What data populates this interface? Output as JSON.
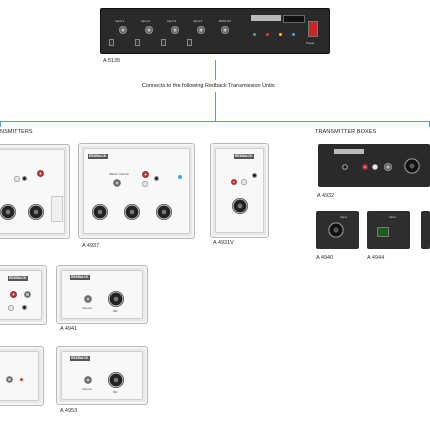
{
  "main_unit": {
    "model": "A 5135",
    "inputs": [
      "Input 1",
      "Input 2",
      "Input 3",
      "Input 4"
    ],
    "bgm_vol": "BGM Vol",
    "power_label": "Power",
    "brand": "REDBACK"
  },
  "connects_text": "Connects to the following Redback Transmission Units",
  "sections": {
    "wall_plates_header": "NSMITTERS",
    "boxes_header": "TRANSMITTER BOXES"
  },
  "plates": [
    {
      "id": "p1",
      "model": ""
    },
    {
      "id": "p2",
      "model": "A 4937"
    },
    {
      "id": "p3",
      "model": "A 4931V"
    },
    {
      "id": "p4",
      "model": ""
    },
    {
      "id": "p5",
      "model": "A 4941"
    },
    {
      "id": "p6",
      "model": ""
    },
    {
      "id": "p7",
      "model": "A 4953"
    }
  ],
  "boxes": [
    {
      "id": "b1",
      "model": "A 4932"
    },
    {
      "id": "b2",
      "model": "A 4940"
    },
    {
      "id": "b3",
      "model": "A 4944"
    }
  ],
  "plate_small_text": {
    "volume": "Volume",
    "mic": "Mic",
    "music": "Music",
    "input": "Input",
    "master_volume": "Master Volume"
  },
  "colors": {
    "connector_line": "#5b9bd5",
    "unit_body": "#2d2d2d",
    "plate_bg": "#e8e8e8"
  }
}
